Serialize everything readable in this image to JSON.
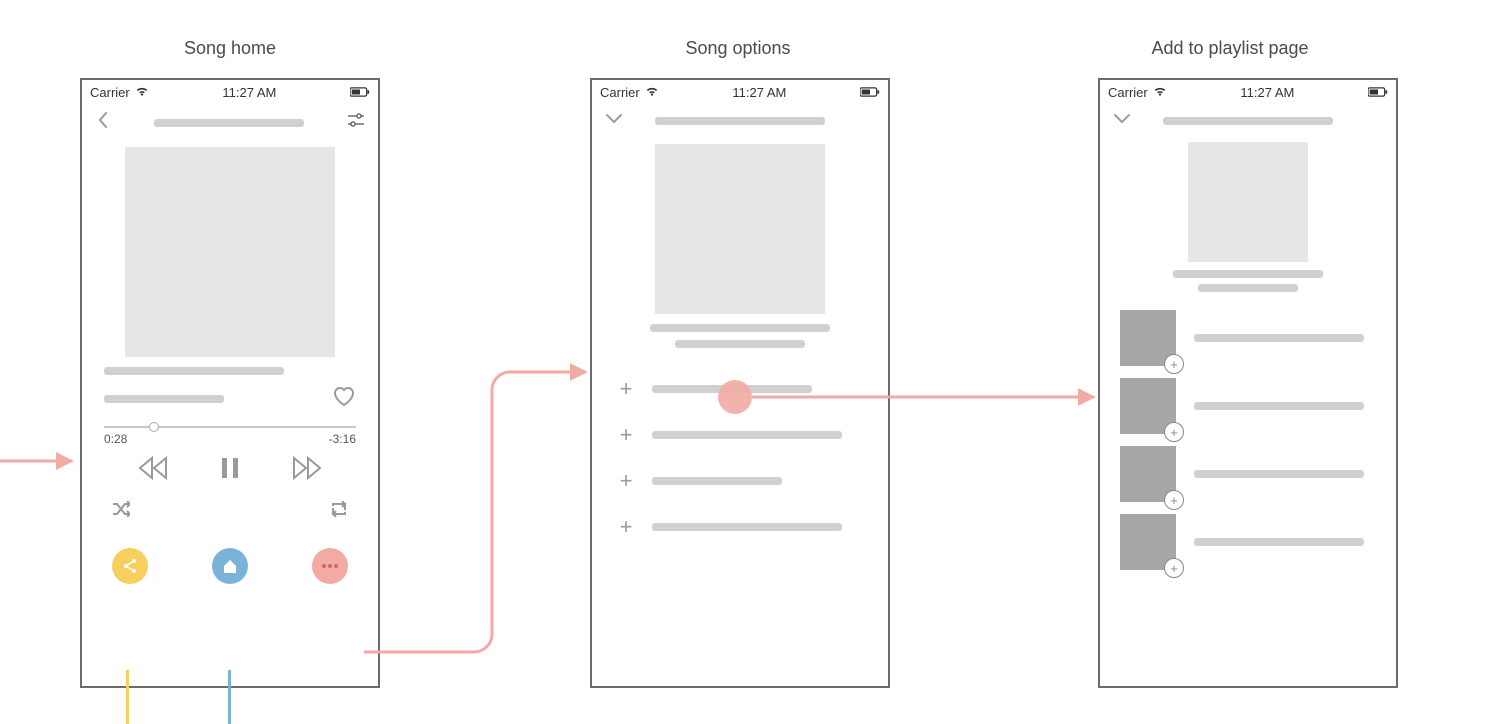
{
  "titles": {
    "song_home": "Song home",
    "song_options": "Song options",
    "add_to_playlist": "Add to playlist page"
  },
  "statusbar": {
    "carrier": "Carrier",
    "time": "11:27 AM"
  },
  "player": {
    "elapsed": "0:28",
    "remaining": "-3:16"
  },
  "colors": {
    "share": "#f6cf5e",
    "home": "#7bb3d8",
    "more": "#f2aaa3",
    "arrow": "#f2aaa3"
  }
}
